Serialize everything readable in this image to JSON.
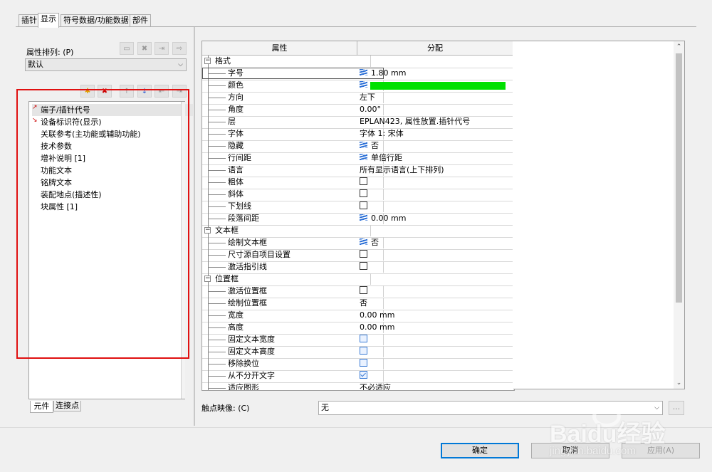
{
  "tabs": [
    {
      "label": "插针"
    },
    {
      "label": "显示"
    },
    {
      "label": "符号数据/功能数据"
    },
    {
      "label": "部件"
    }
  ],
  "left": {
    "sort_label": "属性排列: (P)",
    "sort_value": "默认",
    "items": [
      {
        "label": "端子/插针代号"
      },
      {
        "label": "设备标识符(显示)"
      },
      {
        "label": "关联参考(主功能或辅助功能)"
      },
      {
        "label": "技术参数"
      },
      {
        "label": "增补说明 [1]"
      },
      {
        "label": "功能文本"
      },
      {
        "label": "铭牌文本"
      },
      {
        "label": "装配地点(描述性)"
      },
      {
        "label": "块属性 [1]"
      }
    ],
    "bottom_tabs": [
      {
        "label": "元件"
      },
      {
        "label": "连接点"
      }
    ]
  },
  "grid": {
    "col_property": "属性",
    "col_value": "分配",
    "rows": [
      {
        "name": "格式",
        "value": "",
        "level": "category"
      },
      {
        "name": "字号",
        "value": "1.80 mm",
        "icon": "multi-line-icon"
      },
      {
        "name": "颜色",
        "value": "",
        "icon": "multi-line-icon",
        "color": "#00e000"
      },
      {
        "name": "方向",
        "value": "左下"
      },
      {
        "name": "角度",
        "value": "0.00°"
      },
      {
        "name": "层",
        "value": "EPLAN423, 属性放置.插针代号"
      },
      {
        "name": "字体",
        "value": "字体 1: 宋体"
      },
      {
        "name": "隐藏",
        "value": "否",
        "icon": "multi-line-icon"
      },
      {
        "name": "行间距",
        "value": "单倍行距",
        "icon": "multi-line-icon"
      },
      {
        "name": "语言",
        "value": "所有显示语言(上下排列)"
      },
      {
        "name": "粗体",
        "value": "",
        "checkbox": "unchecked"
      },
      {
        "name": "斜体",
        "value": "",
        "checkbox": "unchecked"
      },
      {
        "name": "下划线",
        "value": "",
        "checkbox": "unchecked"
      },
      {
        "name": "段落间距",
        "value": "0.00 mm",
        "icon": "multi-line-icon"
      },
      {
        "name": "文本框",
        "value": "",
        "level": "category"
      },
      {
        "name": "绘制文本框",
        "value": "否",
        "icon": "multi-line-icon"
      },
      {
        "name": "尺寸源自项目设置",
        "value": "",
        "checkbox": "unchecked"
      },
      {
        "name": "激活指引线",
        "value": "",
        "checkbox": "unchecked"
      },
      {
        "name": "位置框",
        "value": "",
        "level": "category"
      },
      {
        "name": "激活位置框",
        "value": "",
        "checkbox": "unchecked"
      },
      {
        "name": "绘制位置框",
        "value": "否"
      },
      {
        "name": "宽度",
        "value": "0.00 mm"
      },
      {
        "name": "高度",
        "value": "0.00 mm"
      },
      {
        "name": "固定文本宽度",
        "value": "",
        "checkbox": "disabled"
      },
      {
        "name": "固定文本高度",
        "value": "",
        "checkbox": "disabled"
      },
      {
        "name": "移除换位",
        "value": "",
        "checkbox": "disabled"
      },
      {
        "name": "从不分开文字",
        "value": "",
        "checkbox": "checked"
      },
      {
        "name": "适应图形",
        "value": "不必适应"
      }
    ]
  },
  "touch_mapping": {
    "label": "触点映像: (C)",
    "value": "无"
  },
  "buttons": {
    "ok": "确定",
    "cancel": "取消",
    "apply": "应用(A)"
  },
  "watermark": {
    "text": "Baidu经验",
    "url": "jingyan.baidu.com"
  },
  "colors": {
    "highlight_box": "#e01010",
    "accent": "#0078d7"
  }
}
